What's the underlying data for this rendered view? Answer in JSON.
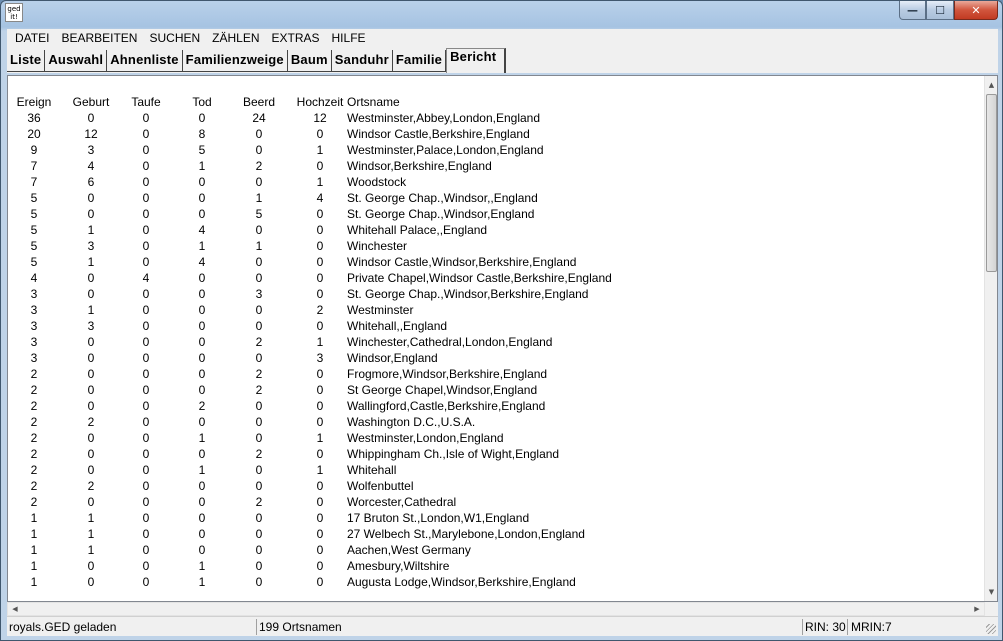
{
  "app_icon_text": "ged\nit!",
  "window_controls": {
    "minimize": "—",
    "maximize": "☐",
    "close": "✕"
  },
  "menu": [
    "DATEI",
    "BEARBEITEN",
    "SUCHEN",
    "ZÄHLEN",
    "EXTRAS",
    "HILFE"
  ],
  "tabs": [
    "Liste",
    "Auswahl",
    "Ahnenliste",
    "Familienzweige",
    "Baum",
    "Sanduhr",
    "Familie",
    "Bericht"
  ],
  "active_tab": "Bericht",
  "report": {
    "headers": [
      "Ereign",
      "Geburt",
      "Taufe",
      "Tod",
      "Beerd",
      "Hochzeit",
      "Ortsname"
    ],
    "rows": [
      [
        "36",
        "0",
        "0",
        "0",
        "24",
        "12",
        "Westminster,Abbey,London,England"
      ],
      [
        "20",
        "12",
        "0",
        "8",
        "0",
        "0",
        "Windsor Castle,Berkshire,England"
      ],
      [
        "9",
        "3",
        "0",
        "5",
        "0",
        "1",
        "Westminster,Palace,London,England"
      ],
      [
        "7",
        "4",
        "0",
        "1",
        "2",
        "0",
        "Windsor,Berkshire,England"
      ],
      [
        "7",
        "6",
        "0",
        "0",
        "0",
        "1",
        "Woodstock"
      ],
      [
        "5",
        "0",
        "0",
        "0",
        "1",
        "4",
        "St. George Chap.,Windsor,,England"
      ],
      [
        "5",
        "0",
        "0",
        "0",
        "5",
        "0",
        "St. George Chap.,Windsor,England"
      ],
      [
        "5",
        "1",
        "0",
        "4",
        "0",
        "0",
        "Whitehall Palace,,England"
      ],
      [
        "5",
        "3",
        "0",
        "1",
        "1",
        "0",
        "Winchester"
      ],
      [
        "5",
        "1",
        "0",
        "4",
        "0",
        "0",
        "Windsor Castle,Windsor,Berkshire,England"
      ],
      [
        "4",
        "0",
        "4",
        "0",
        "0",
        "0",
        "Private Chapel,Windsor Castle,Berkshire,England"
      ],
      [
        "3",
        "0",
        "0",
        "0",
        "3",
        "0",
        "St. George Chap.,Windsor,Berkshire,England"
      ],
      [
        "3",
        "1",
        "0",
        "0",
        "0",
        "2",
        "Westminster"
      ],
      [
        "3",
        "3",
        "0",
        "0",
        "0",
        "0",
        "Whitehall,,England"
      ],
      [
        "3",
        "0",
        "0",
        "0",
        "2",
        "1",
        "Winchester,Cathedral,London,England"
      ],
      [
        "3",
        "0",
        "0",
        "0",
        "0",
        "3",
        "Windsor,England"
      ],
      [
        "2",
        "0",
        "0",
        "0",
        "2",
        "0",
        "Frogmore,Windsor,Berkshire,England"
      ],
      [
        "2",
        "0",
        "0",
        "0",
        "2",
        "0",
        "St George Chapel,Windsor,England"
      ],
      [
        "2",
        "0",
        "0",
        "2",
        "0",
        "0",
        "Wallingford,Castle,Berkshire,England"
      ],
      [
        "2",
        "2",
        "0",
        "0",
        "0",
        "0",
        "Washington D.C.,U.S.A."
      ],
      [
        "2",
        "0",
        "0",
        "1",
        "0",
        "1",
        "Westminster,London,England"
      ],
      [
        "2",
        "0",
        "0",
        "0",
        "2",
        "0",
        "Whippingham Ch.,Isle of Wight,England"
      ],
      [
        "2",
        "0",
        "0",
        "1",
        "0",
        "1",
        "Whitehall"
      ],
      [
        "2",
        "2",
        "0",
        "0",
        "0",
        "0",
        "Wolfenbuttel"
      ],
      [
        "2",
        "0",
        "0",
        "0",
        "2",
        "0",
        "Worcester,Cathedral"
      ],
      [
        "1",
        "1",
        "0",
        "0",
        "0",
        "0",
        "17 Bruton St.,London,W1,England"
      ],
      [
        "1",
        "1",
        "0",
        "0",
        "0",
        "0",
        "27 Welbech St.,Marylebone,London,England"
      ],
      [
        "1",
        "1",
        "0",
        "0",
        "0",
        "0",
        "Aachen,West Germany"
      ],
      [
        "1",
        "0",
        "0",
        "1",
        "0",
        "0",
        "Amesbury,Wiltshire"
      ],
      [
        "1",
        "0",
        "0",
        "1",
        "0",
        "0",
        "Augusta Lodge,Windsor,Berkshire,England"
      ]
    ]
  },
  "scroll_arrows": {
    "up": "▲",
    "down": "▼",
    "left": "◀",
    "right": "▶"
  },
  "status": {
    "file": "royals.GED geladen",
    "count": "199 Ortsnamen",
    "rin": "RIN: 30",
    "mrin": "MRIN:7"
  }
}
